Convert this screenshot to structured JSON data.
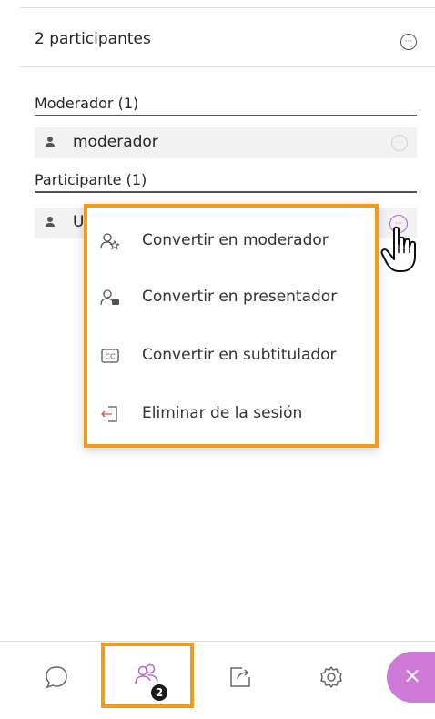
{
  "panel": {
    "participants_count_label": "2 participantes",
    "header_more_glyph": "···"
  },
  "sections": [
    {
      "title": "Moderador (1)",
      "members": [
        {
          "name": "moderador"
        }
      ]
    },
    {
      "title": "Participante (1)",
      "members": [
        {
          "name": "U"
        }
      ]
    }
  ],
  "context_menu": {
    "items": [
      {
        "label": "Convertir en moderador",
        "icon": "make-moderator-icon"
      },
      {
        "label": "Convertir en presentador",
        "icon": "make-presenter-icon"
      },
      {
        "label": "Convertir en subtitulador",
        "icon": "closed-caption-icon"
      },
      {
        "label": "Eliminar de la sesión",
        "icon": "remove-from-session-icon"
      }
    ],
    "highlight_color": "#f29b1f"
  },
  "bottom_nav": {
    "items": [
      {
        "name": "chat",
        "icon": "chat-bubble-icon"
      },
      {
        "name": "participants",
        "icon": "participants-icon",
        "badge": "2"
      },
      {
        "name": "share",
        "icon": "share-content-icon"
      },
      {
        "name": "settings",
        "icon": "gear-icon"
      }
    ],
    "close_glyph": "×",
    "close_color": "#cf7ad8"
  },
  "colors": {
    "accent": "#b366d6",
    "highlight": "#f29b1f"
  }
}
